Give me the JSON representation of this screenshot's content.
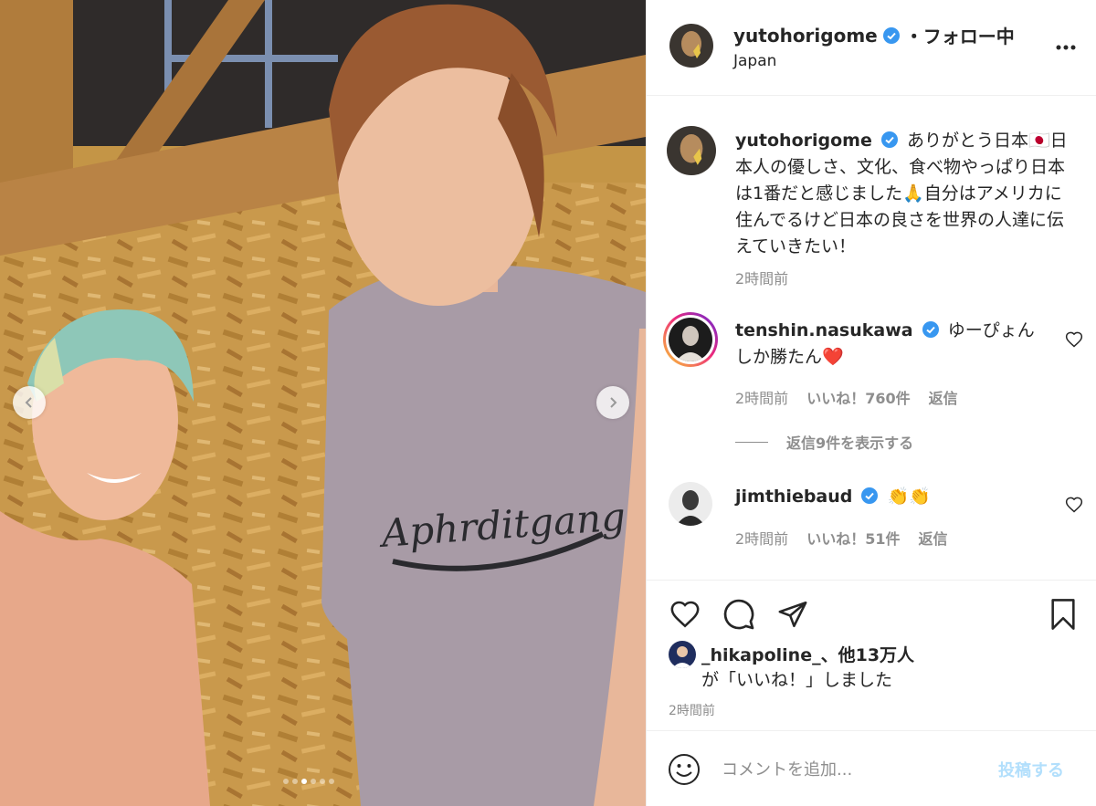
{
  "post": {
    "username": "yutohorigome",
    "follow_status": "・フォロー中",
    "location": "Japan",
    "more_icon": "more-horizontal-icon",
    "nav_prev_icon": "chevron-left-icon",
    "nav_next_icon": "chevron-right-icon",
    "carousel": {
      "total": 6,
      "active_index": 2
    },
    "shirt_text": "Aphrditgang"
  },
  "caption": {
    "username": "yutohorigome",
    "text": "ありがとう日本🇯🇵日本人の優しさ、文化、食べ物やっぱり日本は1番だと感じました🙏自分はアメリカに住んでるけど日本の良さを世界の人達に伝えていきたい！",
    "time": "2時間前"
  },
  "comments": [
    {
      "username": "tenshin.nasukawa",
      "text": "ゆーぴょんしか勝たん❤️",
      "time": "2時間前",
      "likes": "いいね！760件",
      "reply_label": "返信",
      "view_replies": "返信9件を表示する"
    },
    {
      "username": "jimthiebaud",
      "text": "👏👏",
      "time": "2時間前",
      "likes": "いいね！51件",
      "reply_label": "返信"
    }
  ],
  "actions": {
    "like_icon": "heart-icon",
    "comment_icon": "comment-icon",
    "share_icon": "paper-plane-icon",
    "save_icon": "bookmark-icon",
    "likes_user": "_hikapoline_",
    "likes_rest": "、他13万人",
    "likes_suffix": "が「いいね！」しました",
    "timestamp": "2時間前"
  },
  "add_comment": {
    "placeholder": "コメントを追加...",
    "post_label": "投稿する",
    "emoji_icon": "smiley-icon"
  },
  "colors": {
    "text": "#262626",
    "secondary": "#8e8e8e",
    "verified": "#3897f0",
    "like_red": "#ed4956",
    "post_disabled": "#b2dffc",
    "border": "#efefef"
  }
}
